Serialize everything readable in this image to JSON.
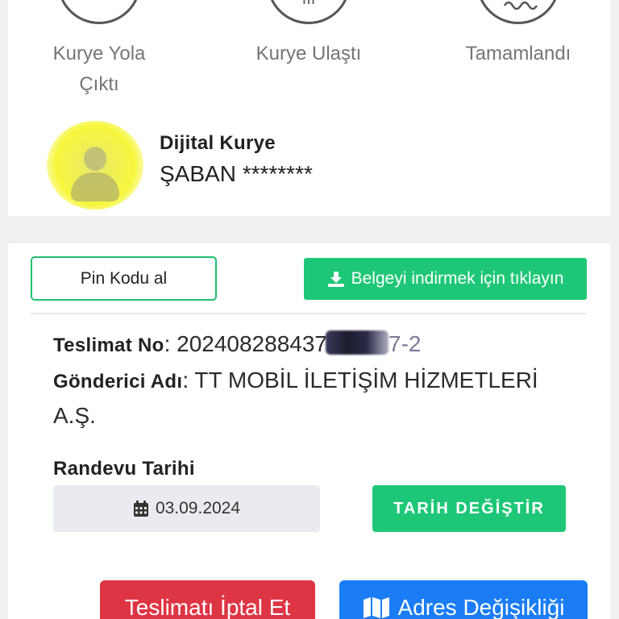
{
  "steps": [
    {
      "label_line1": "Kurye Yola",
      "label_line2": "Çıktı",
      "icon": "courier-on-way-icon"
    },
    {
      "label_line1": "Kurye Ulaştı",
      "label_line2": "",
      "icon": "courier-arrived-icon"
    },
    {
      "label_line1": "Tamamlandı",
      "label_line2": "",
      "icon": "completed-icon"
    }
  ],
  "courier": {
    "title": "Dijital Kurye",
    "name": "ŞABAN ********",
    "avatar_highlight_color": "#f6f63c"
  },
  "actions": {
    "pin_label": "Pin Kodu al",
    "download_label": "Belgeyi indirmek için tıklayın",
    "download_icon": "download-icon"
  },
  "shipment": {
    "delivery_no_label": "Teslimat No",
    "delivery_no_visible": "202408288437",
    "delivery_no_suffix": "7-2",
    "sender_label": "Gönderici Adı",
    "sender_value": "TT MOBİL İLETİŞİM HİZMETLERİ A.Ş."
  },
  "appointment": {
    "label": "Randevu Tarihi",
    "date": "03.09.2024",
    "calendar_icon": "calendar-icon",
    "change_label": "TARİH DEĞİŞTİR"
  },
  "footer": {
    "cancel_label": "Teslimatı İptal Et",
    "address_label": "Adres Değişikliği",
    "address_icon": "map-icon"
  },
  "colors": {
    "accent_green": "#1ec777",
    "danger_red": "#de3545",
    "primary_blue": "#1a7df5"
  }
}
